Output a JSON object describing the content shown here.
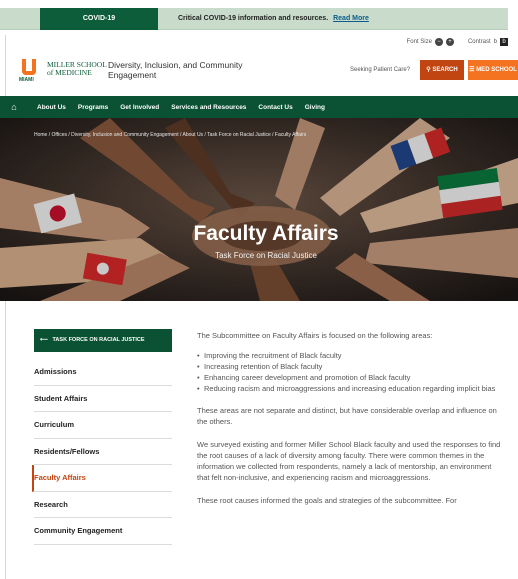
{
  "alert": {
    "tag": "COVID-19",
    "message": "Critical COVID-19 information and resources.",
    "link": "Read More"
  },
  "utility": {
    "font_size_label": "Font Size",
    "contrast_label": "Contrast"
  },
  "branding": {
    "logo_um": "U",
    "logo_line1": "MILLER SCHOOL",
    "logo_line2": "of MEDICINE",
    "site_name_line1": "Diversity, Inclusion, and Community",
    "site_name_line2": "Engagement",
    "seeking_care": "Seeking Patient Care?",
    "search_label": "SEARCH",
    "med_school_label": "MED SCHOOL"
  },
  "nav": {
    "items": [
      "About Us",
      "Programs",
      "Get Involved",
      "Services and Resources",
      "Contact Us",
      "Giving"
    ]
  },
  "hero": {
    "breadcrumb": "Home / Offices / Diversity, Inclusion and Community Engagement / About Us / Task Force on Racial Justice / Faculty Affairs",
    "title": "Faculty Affairs",
    "subtitle": "Task Force on Racial Justice"
  },
  "sidebar": {
    "header": "TASK FORCE ON RACIAL JUSTICE",
    "items": [
      "Admissions",
      "Student Affairs",
      "Curriculum",
      "Residents/Fellows",
      "Faculty Affairs",
      "Research",
      "Community Engagement"
    ]
  },
  "content": {
    "intro": "The Subcommittee on Faculty Affairs is focused on the following areas:",
    "bullets": [
      "Improving the recruitment of Black faculty",
      "Increasing retention of Black faculty",
      "Enhancing career development and promotion of Black faculty",
      "Reducing racism and microaggressions and increasing education regarding implicit bias"
    ],
    "para2": "These areas are not separate and distinct, but have considerable overlap and influence on the others.",
    "para3": "We surveyed existing and former Miller School Black faculty and used the responses to find the root causes of a lack of diversity among faculty. There were common themes in the information we collected from respondents, namely a lack of mentorship, an environment that felt non-inclusive, and experiencing racism and microaggressions.",
    "para4": "These root causes informed the goals and strategies of the subcommittee. For"
  }
}
